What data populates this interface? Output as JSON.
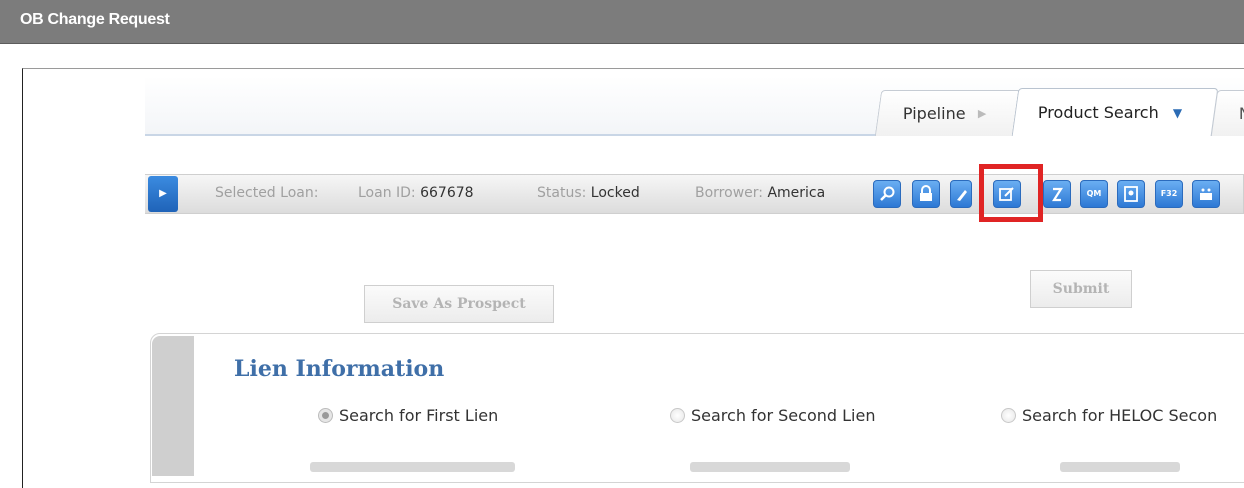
{
  "window": {
    "title": "OB Change Request"
  },
  "tabs": [
    {
      "label": "Pipeline"
    },
    {
      "label": "Product Search"
    },
    {
      "label": "N"
    }
  ],
  "toolbar": {
    "selected_loan_label": "Selected Loan:",
    "loan_id_label": "Loan ID:",
    "loan_id_value": "667678",
    "status_label": "Status:",
    "status_value": "Locked",
    "borrower_label": "Borrower:",
    "borrower_value": "America",
    "icons": [
      "search-icon",
      "lock-icon",
      "eraser-icon",
      "edit-icon",
      "calculator-icon",
      "qm-icon",
      "document-icon",
      "f32-icon",
      "cake-icon"
    ],
    "qm_text": "QM",
    "f32_text": "F32"
  },
  "actions": {
    "save_as_prospect": "Save As Prospect",
    "submit": "Submit"
  },
  "lien": {
    "title": "Lien Information",
    "options": [
      {
        "label": "Search for First Lien",
        "selected": true
      },
      {
        "label": "Search for Second Lien",
        "selected": false
      },
      {
        "label": "Search for HELOC Secon",
        "selected": false
      }
    ]
  },
  "colors": {
    "title_bar": "#7c7c7c",
    "accent_blue": "#2d78d4",
    "section_title": "#3f6fa8",
    "highlight": "#e02424"
  }
}
